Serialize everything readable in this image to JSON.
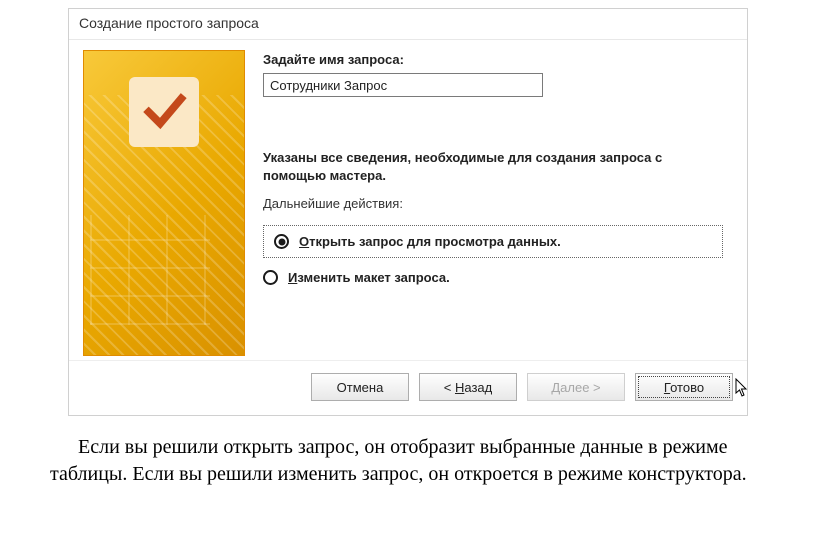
{
  "dialog": {
    "title": "Создание простого запроса",
    "prompt_label": "Задайте имя запроса:",
    "query_name": "Сотрудники Запрос",
    "info_text": "Указаны все сведения, необходимые для создания запроса с помощью мастера.",
    "next_actions_label": "Дальнейшие действия:",
    "options": {
      "open": {
        "prefix": "О",
        "rest": "ткрыть запрос для просмотра данных."
      },
      "edit": {
        "prefix": "И",
        "rest": "зменить макет запроса."
      }
    },
    "buttons": {
      "cancel": "Отмена",
      "back_prefix": "< ",
      "back_u": "Н",
      "back_rest": "азад",
      "next_prefix": "Д",
      "next_rest": "алее >",
      "finish_u": "Г",
      "finish_rest": "отово"
    }
  },
  "caption": "Если вы решили открыть запрос, он отобразит выбранные данные в режиме таблицы. Если вы решили изменить запрос, он откроется в режиме конструктора."
}
